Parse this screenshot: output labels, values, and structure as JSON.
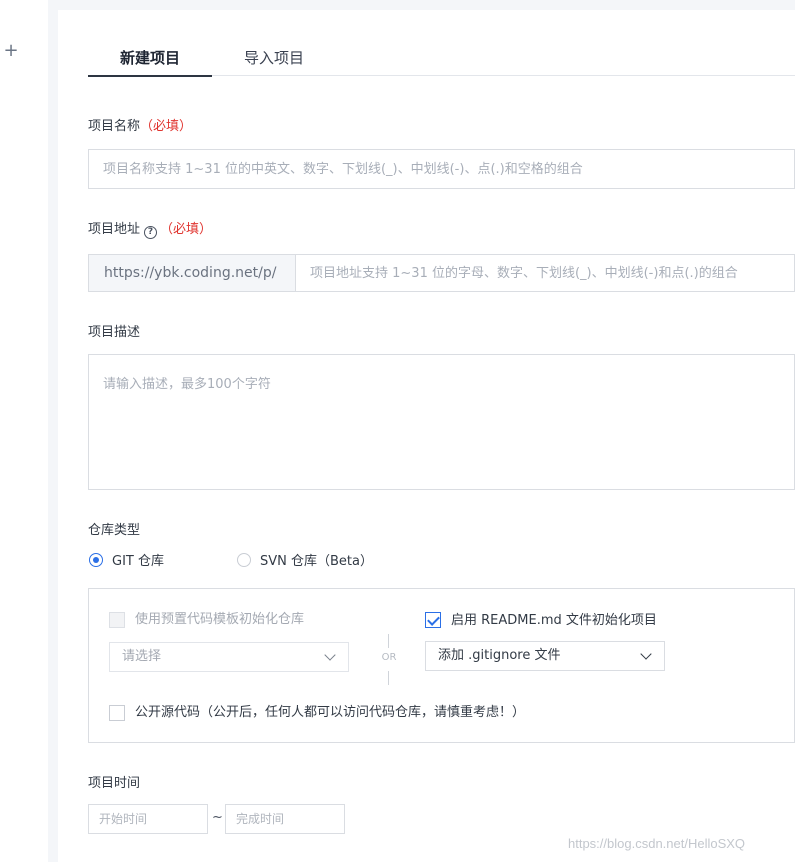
{
  "sidebar": {
    "add_icon": "plus-icon"
  },
  "tabs": [
    {
      "label": "新建项目",
      "active": true
    },
    {
      "label": "导入项目",
      "active": false
    }
  ],
  "project_name": {
    "label": "项目名称",
    "required": "（必填）",
    "placeholder": "项目名称支持 1~31 位的中英文、数字、下划线(_)、中划线(-)、点(.)和空格的组合"
  },
  "project_url": {
    "label": "项目地址",
    "help_icon": "question-circle-icon",
    "required": "（必填）",
    "prefix": "https://ybk.coding.net/p/",
    "placeholder": "项目地址支持 1~31 位的字母、数字、下划线(_)、中划线(-)和点(.)的组合"
  },
  "project_desc": {
    "label": "项目描述",
    "placeholder": "请输入描述，最多100个字符"
  },
  "repo_type": {
    "label": "仓库类型",
    "options": [
      {
        "label": "GIT 仓库",
        "selected": true
      },
      {
        "label": "SVN 仓库（Beta）",
        "selected": false
      }
    ]
  },
  "repo_init": {
    "template_checkbox": {
      "label": "使用预置代码模板初始化仓库",
      "checked": false,
      "disabled": true
    },
    "template_select": {
      "value": "请选择"
    },
    "or_text": "OR",
    "readme_checkbox": {
      "label": "启用 README.md 文件初始化项目",
      "checked": true
    },
    "gitignore_select": {
      "value": "添加 .gitignore 文件"
    },
    "public_checkbox": {
      "label": "公开源代码（公开后，任何人都可以访问代码仓库，请慎重考虑！）",
      "checked": false
    }
  },
  "project_time": {
    "label": "项目时间",
    "start_placeholder": "开始时间",
    "separator": "~",
    "end_placeholder": "完成时间"
  },
  "watermark": "https://blog.csdn.net/HelloSXQ",
  "colors": {
    "accent": "#2b6fe6",
    "required": "#e0342f"
  }
}
